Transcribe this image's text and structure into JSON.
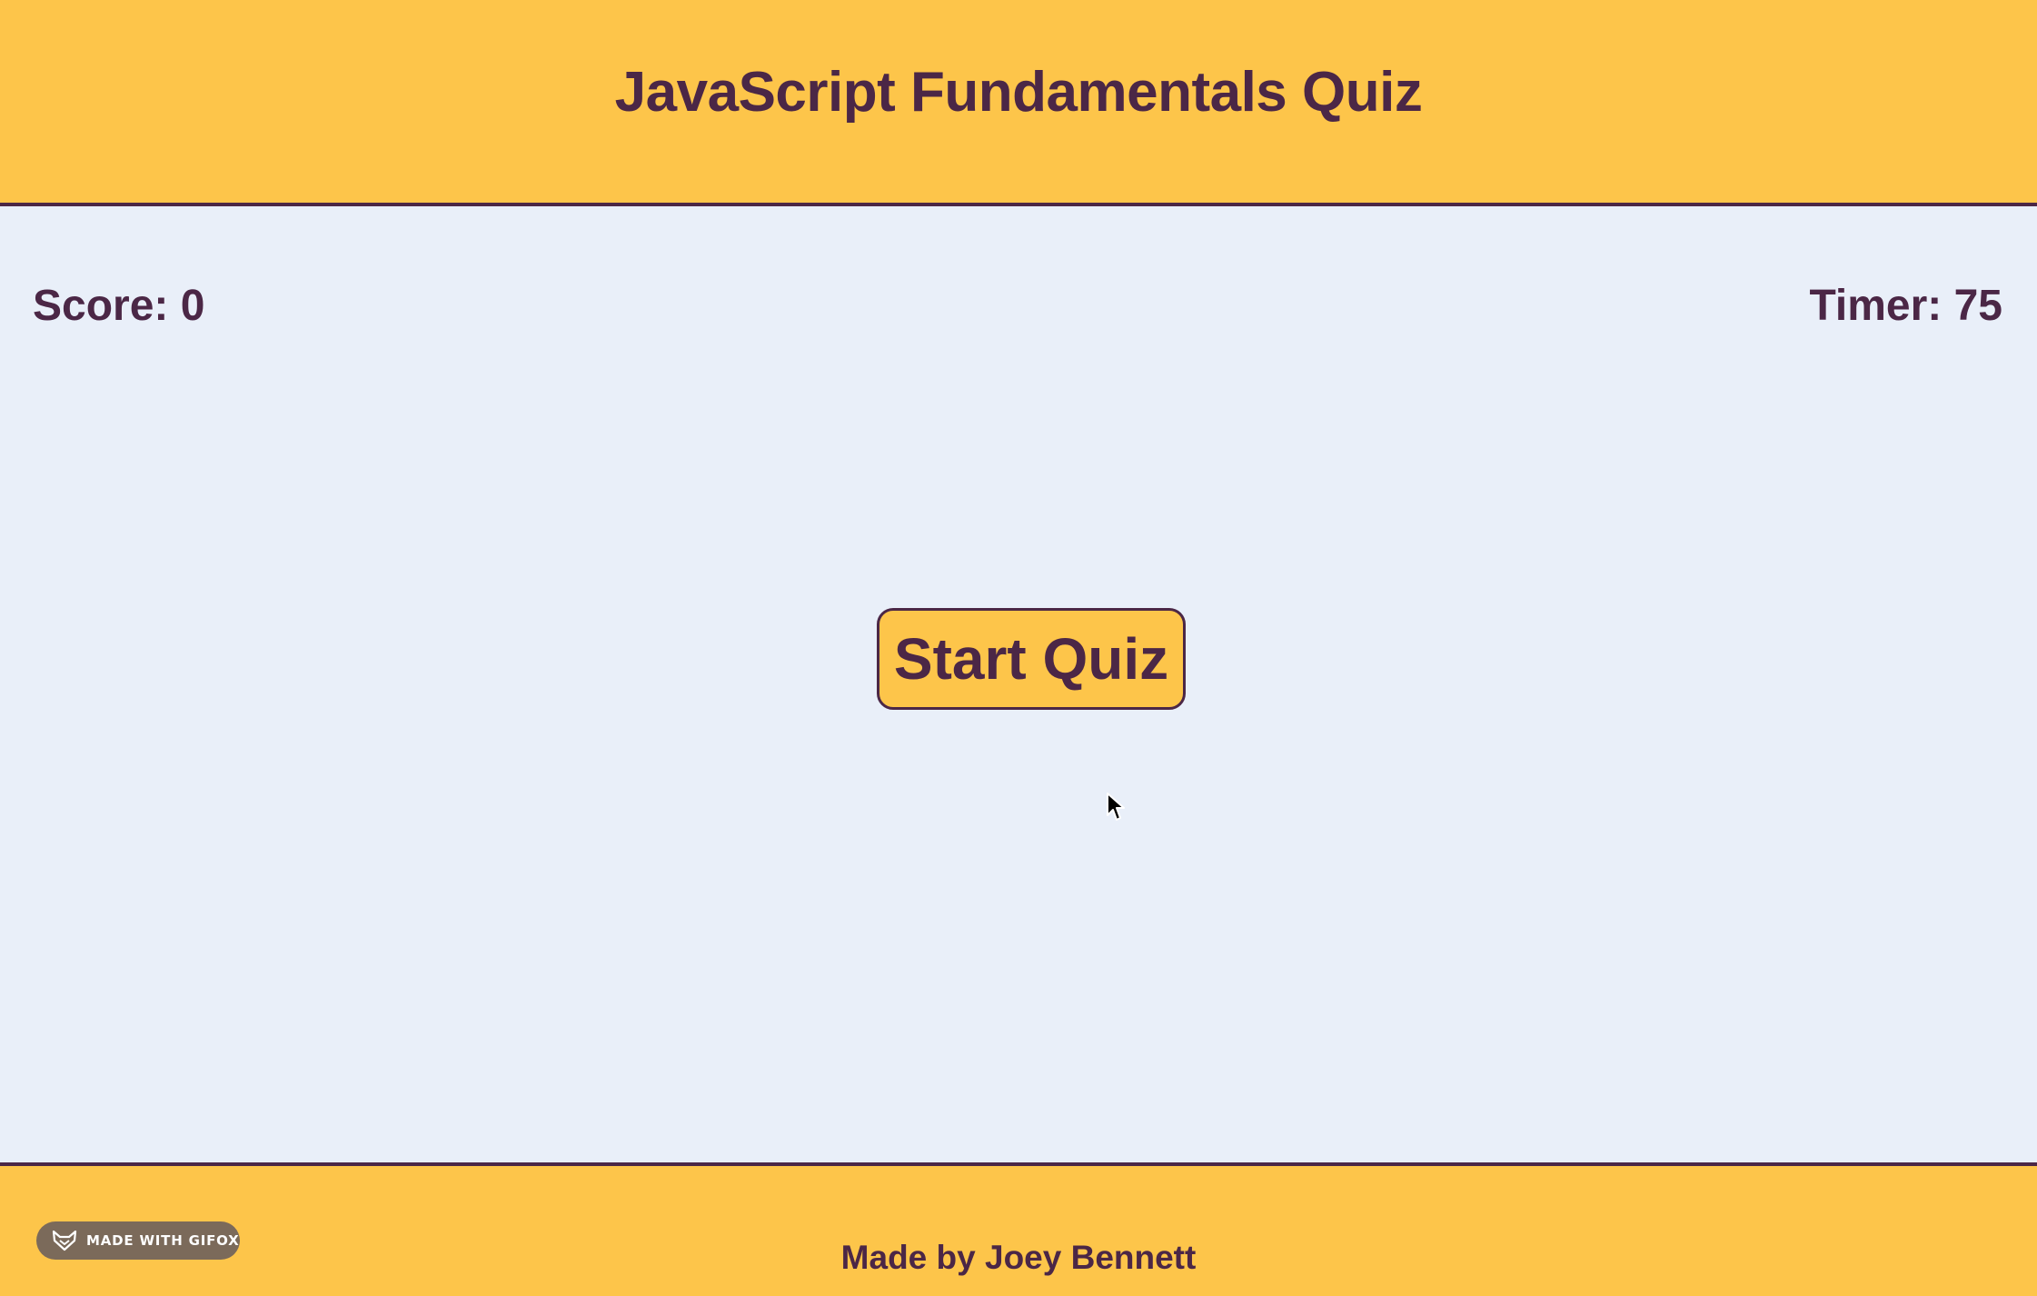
{
  "header": {
    "title": "JavaScript Fundamentals Quiz"
  },
  "stats": {
    "score": "Score: 0",
    "timer": "Timer: 75"
  },
  "main": {
    "start_button_label": "Start Quiz"
  },
  "footer": {
    "credit": "Made by Joey Bennett",
    "badge": "MADE WITH GIFOX"
  },
  "colors": {
    "accent_yellow": "#fdc54a",
    "text_purple": "#4b2746",
    "main_background": "#e9eff9",
    "badge_background": "#7b6a5a"
  },
  "icons": {
    "cursor": "mouse-pointer-icon",
    "badge": "fox-icon"
  }
}
